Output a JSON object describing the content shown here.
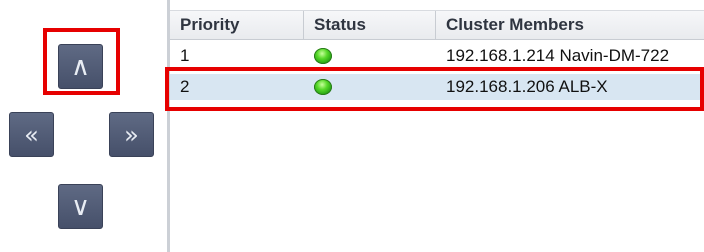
{
  "nav": {
    "up_label": "∧",
    "left_label": "«",
    "right_label": "»",
    "down_label": "∨"
  },
  "table": {
    "columns": [
      "Priority",
      "Status",
      "Cluster Members"
    ],
    "rows": [
      {
        "priority": "1",
        "status": "green-led",
        "member": "192.168.1.214 Navin-DM-722"
      },
      {
        "priority": "2",
        "status": "green-led",
        "member": "192.168.1.206 ALB-X",
        "selected": true
      }
    ]
  },
  "colors": {
    "highlight_border": "#e60000",
    "selected_row": "#d8e6f2",
    "button_bg": "#505a74"
  }
}
